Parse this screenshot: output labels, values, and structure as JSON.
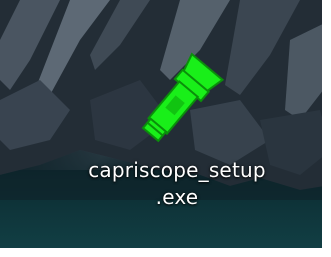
{
  "desktop": {
    "icon": {
      "icon_name": "flashlight-icon",
      "icon_color": "#19ef19",
      "label_line1": "capriscope_setup",
      "label_line2": ".exe"
    }
  }
}
